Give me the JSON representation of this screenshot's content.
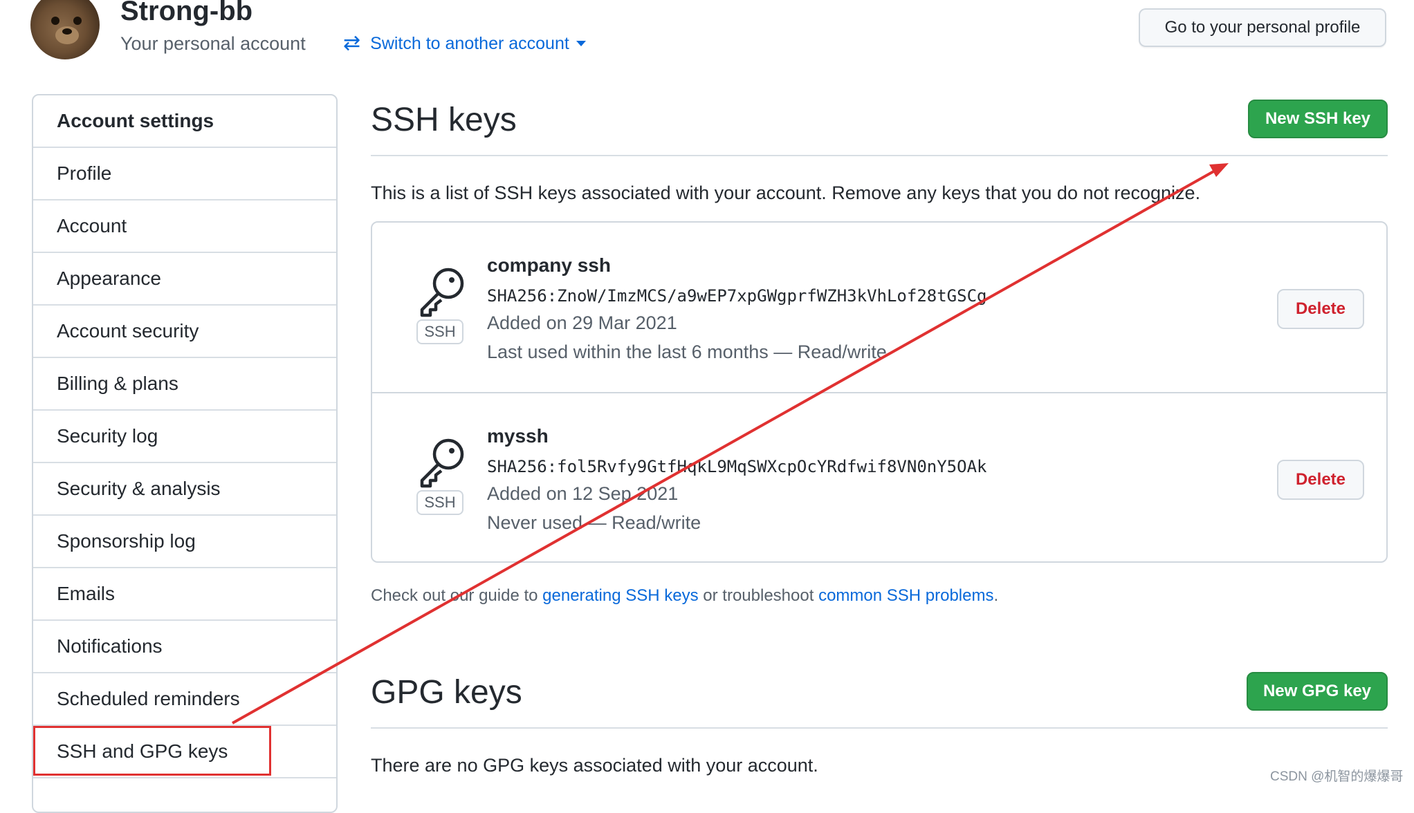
{
  "header": {
    "user_name": "Strong-bb",
    "user_subtitle": "Your personal account",
    "switch_account_label": "Switch to another account",
    "profile_button_label": "Go to your personal profile"
  },
  "sidebar": {
    "heading": "Account settings",
    "items": [
      {
        "label": "Profile"
      },
      {
        "label": "Account"
      },
      {
        "label": "Appearance"
      },
      {
        "label": "Account security"
      },
      {
        "label": "Billing & plans"
      },
      {
        "label": "Security log"
      },
      {
        "label": "Security & analysis"
      },
      {
        "label": "Sponsorship log"
      },
      {
        "label": "Emails"
      },
      {
        "label": "Notifications"
      },
      {
        "label": "Scheduled reminders"
      },
      {
        "label": "SSH and GPG keys"
      }
    ]
  },
  "ssh": {
    "title": "SSH keys",
    "new_button_label": "New SSH key",
    "description": "This is a list of SSH keys associated with your account. Remove any keys that you do not recognize.",
    "keys": [
      {
        "badge": "SSH",
        "title": "company ssh",
        "fingerprint": "SHA256:ZnoW/ImzMCS/a9wEP7xpGWgprfWZH3kVhLof28tGSCg",
        "added": "Added on 29 Mar 2021",
        "usage": "Last used within the last 6 months — Read/write",
        "delete_label": "Delete"
      },
      {
        "badge": "SSH",
        "title": "myssh",
        "fingerprint": "SHA256:fol5Rvfy9GtfHqkL9MqSWXcpOcYRdfwif8VN0nY5OAk",
        "added": "Added on 12 Sep 2021",
        "usage": "Never used — Read/write",
        "delete_label": "Delete"
      }
    ],
    "guide": {
      "prefix": "Check out our guide to ",
      "link1": "generating SSH keys",
      "middle": " or troubleshoot ",
      "link2": "common SSH problems",
      "suffix": "."
    }
  },
  "gpg": {
    "title": "GPG keys",
    "new_button_label": "New GPG key",
    "empty_message": "There are no GPG keys associated with your account."
  },
  "watermark": "CSDN @机智的爆爆哥",
  "colors": {
    "link": "#0969da",
    "primary_button": "#2da44e",
    "danger_text": "#cf222e",
    "annotation": "#e03131"
  },
  "icons": {
    "avatar": "avatar",
    "switch": "arrows-swap-icon",
    "key": "key-icon"
  }
}
